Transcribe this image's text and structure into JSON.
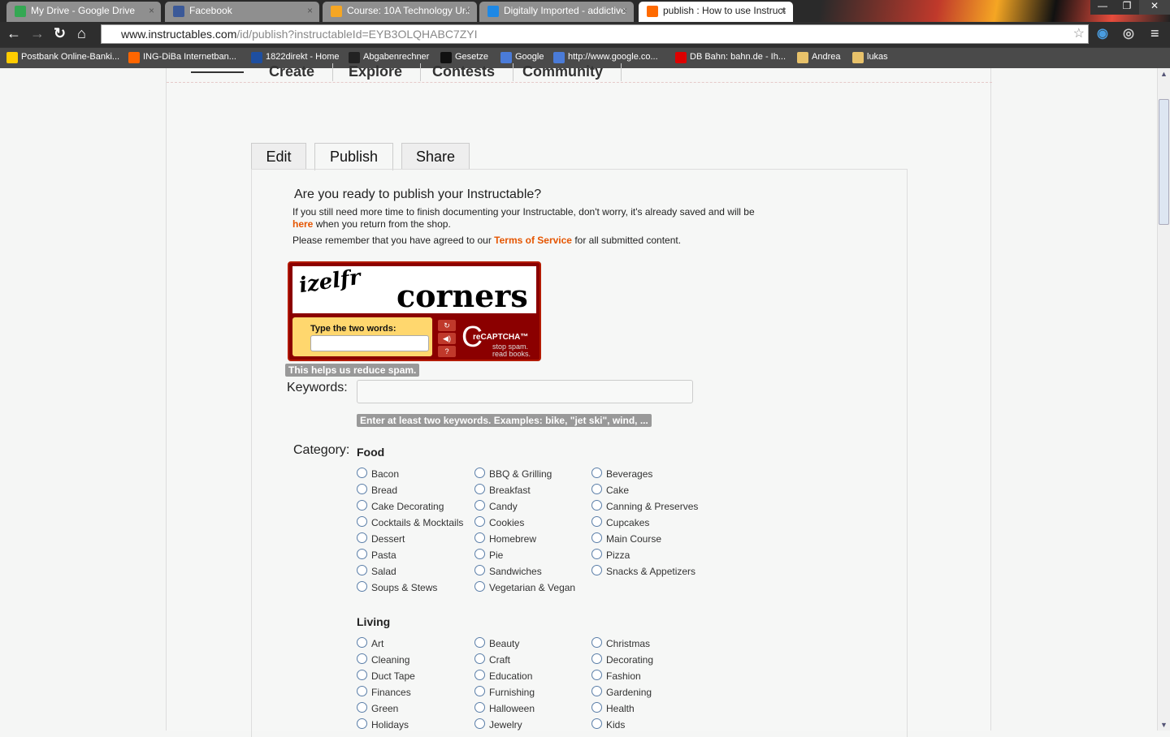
{
  "browser": {
    "tabs": [
      {
        "title": "My Drive - Google Drive",
        "color": "#34a853"
      },
      {
        "title": "Facebook",
        "color": "#3b5998"
      },
      {
        "title": "Course: 10A Technology Uni",
        "color": "#f5a623"
      },
      {
        "title": "Digitally Imported - addictive",
        "color": "#1e88e5"
      },
      {
        "title": "publish : How to use Instruct",
        "color": "#ff6a00",
        "active": true
      }
    ],
    "url_host": "www.instructables.com",
    "url_path": "/id/publish?instructableId=EYB3OLQHABC7ZYI",
    "bookmarks": [
      {
        "label": "Postbank Online-Banki...",
        "color": "#ffcc00"
      },
      {
        "label": "ING-DiBa Internetban...",
        "color": "#ff6600"
      },
      {
        "label": "1822direkt - Home",
        "color": "#1e4fa0"
      },
      {
        "label": "Abgabenrechner",
        "color": "#222"
      },
      {
        "label": "Gesetze",
        "color": "#111"
      },
      {
        "label": "Google",
        "color": "#4a7bd8"
      },
      {
        "label": "http://www.google.co...",
        "color": "#4a7bd8"
      },
      {
        "label": "DB Bahn: bahn.de - Ih...",
        "color": "#d00"
      },
      {
        "label": "Andrea",
        "color": "#e8c26a"
      },
      {
        "label": "lukas",
        "color": "#e8c26a"
      }
    ]
  },
  "site_nav": [
    "Create",
    "Explore",
    "Contests",
    "Community"
  ],
  "tabs": [
    "Edit",
    "Publish",
    "Share"
  ],
  "heading": "Are you ready to publish your Instructable?",
  "intro1": "If you still need more time to finish documenting your Instructable, don't worry, it's already saved and will be",
  "intro_link": "here",
  "intro2": " when you return from the shop.",
  "tos_pre": "Please remember that you have agreed to our ",
  "tos_link": "Terms of Service",
  "tos_post": " for all submitted content.",
  "captcha": {
    "word1": "izelfr",
    "word2": "corners",
    "prompt": "Type the two words:",
    "brand": "reCAPTCHA™",
    "slogan1": "stop spam.",
    "slogan2": "read books."
  },
  "spam_tip": "This helps us reduce spam.",
  "keywords_label": "Keywords:",
  "keywords_value": "",
  "keywords_tip": "Enter at least two keywords. Examples: bike, \"jet ski\", wind, ...",
  "category_label": "Category:",
  "sections": [
    {
      "title": "Food",
      "options": [
        "Bacon",
        "BBQ & Grilling",
        "Beverages",
        "Bread",
        "Breakfast",
        "Cake",
        "Cake Decorating",
        "Candy",
        "Canning & Preserves",
        "Cocktails & Mocktails",
        "Cookies",
        "Cupcakes",
        "Dessert",
        "Homebrew",
        "Main Course",
        "Pasta",
        "Pie",
        "Pizza",
        "Salad",
        "Sandwiches",
        "Snacks & Appetizers",
        "Soups & Stews",
        "Vegetarian & Vegan"
      ]
    },
    {
      "title": "Living",
      "options": [
        "Art",
        "Beauty",
        "Christmas",
        "Cleaning",
        "Craft",
        "Decorating",
        "Duct Tape",
        "Education",
        "Fashion",
        "Finances",
        "Furnishing",
        "Gardening",
        "Green",
        "Halloween",
        "Health",
        "Holidays",
        "Jewelry",
        "Kids"
      ]
    }
  ]
}
